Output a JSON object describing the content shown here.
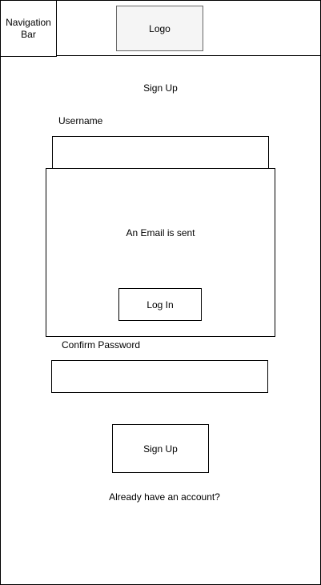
{
  "nav": {
    "label": "Navigation Bar",
    "logo": "Logo"
  },
  "form": {
    "title": "Sign Up",
    "username_label": "Username",
    "confirm_password_label": "Confirm Password",
    "signup_button": "Sign Up",
    "login_link": "Already have an account?"
  },
  "modal": {
    "message": "An Email is sent",
    "login_button": "Log In"
  }
}
